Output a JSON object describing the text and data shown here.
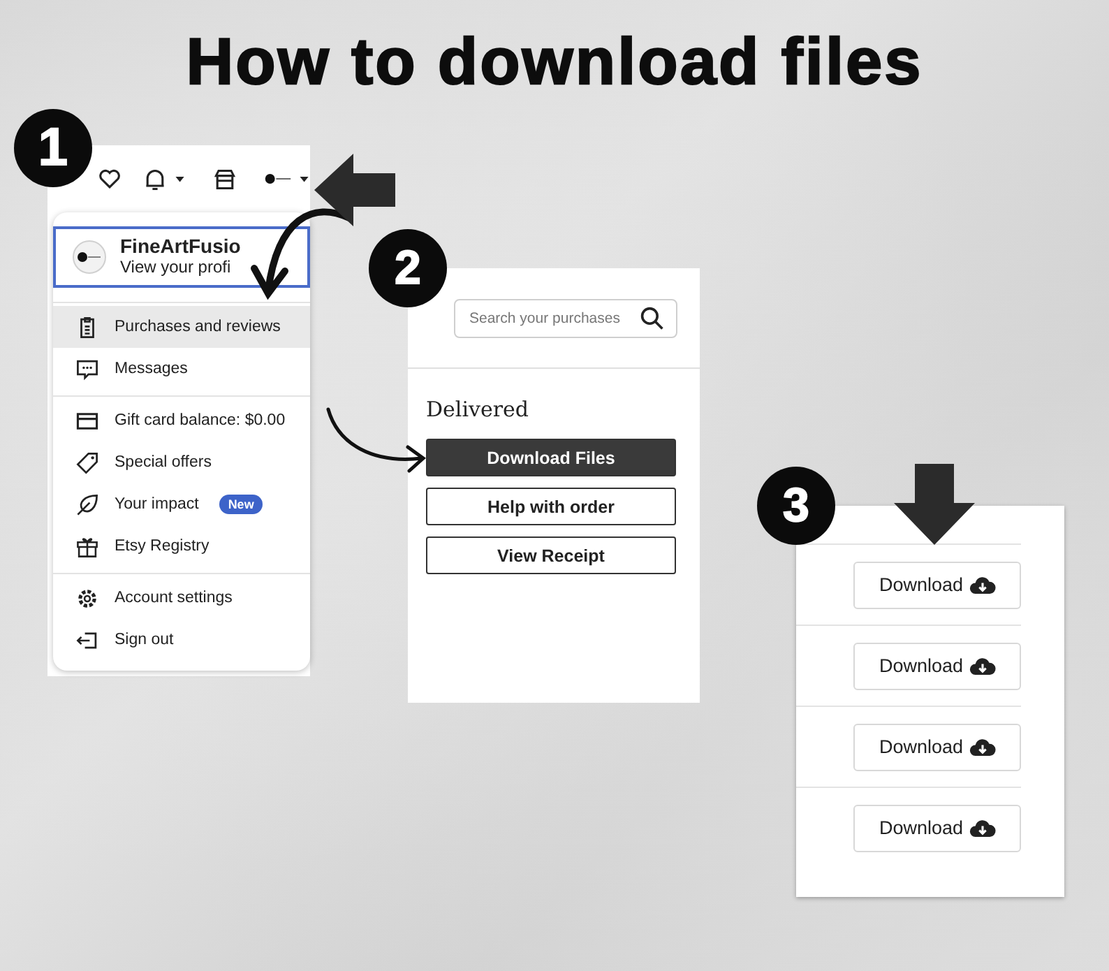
{
  "title": "How to download files",
  "menu_panel": {
    "step": "1",
    "profile": {
      "name": "FineArtFusio",
      "link": "View your profi",
      "focused": true
    },
    "sections": [
      [
        {
          "label": "Purchases and reviews",
          "selected": true
        },
        {
          "label": "Messages",
          "selected": false
        }
      ],
      [
        {
          "label": "Gift card balance: $0.00",
          "selected": false
        },
        {
          "label": "Special offers",
          "selected": false
        },
        {
          "label": "Your impact",
          "badge": "New",
          "selected": false
        },
        {
          "label": "Etsy Registry",
          "selected": false
        }
      ],
      [
        {
          "label": "Account settings",
          "selected": false
        },
        {
          "label": "Sign out",
          "selected": false
        }
      ]
    ]
  },
  "purchases_panel": {
    "step": "2",
    "search": {
      "placeholder": "Search your purchases"
    },
    "heading": "Delivered",
    "buttons": [
      {
        "label": "Download Files",
        "primary": true
      },
      {
        "label": "Help with order",
        "primary": false
      },
      {
        "label": "View Receipt",
        "primary": false
      }
    ]
  },
  "downloads_panel": {
    "step": "3",
    "buttons": [
      "Download",
      "Download",
      "Download",
      "Download"
    ]
  }
}
